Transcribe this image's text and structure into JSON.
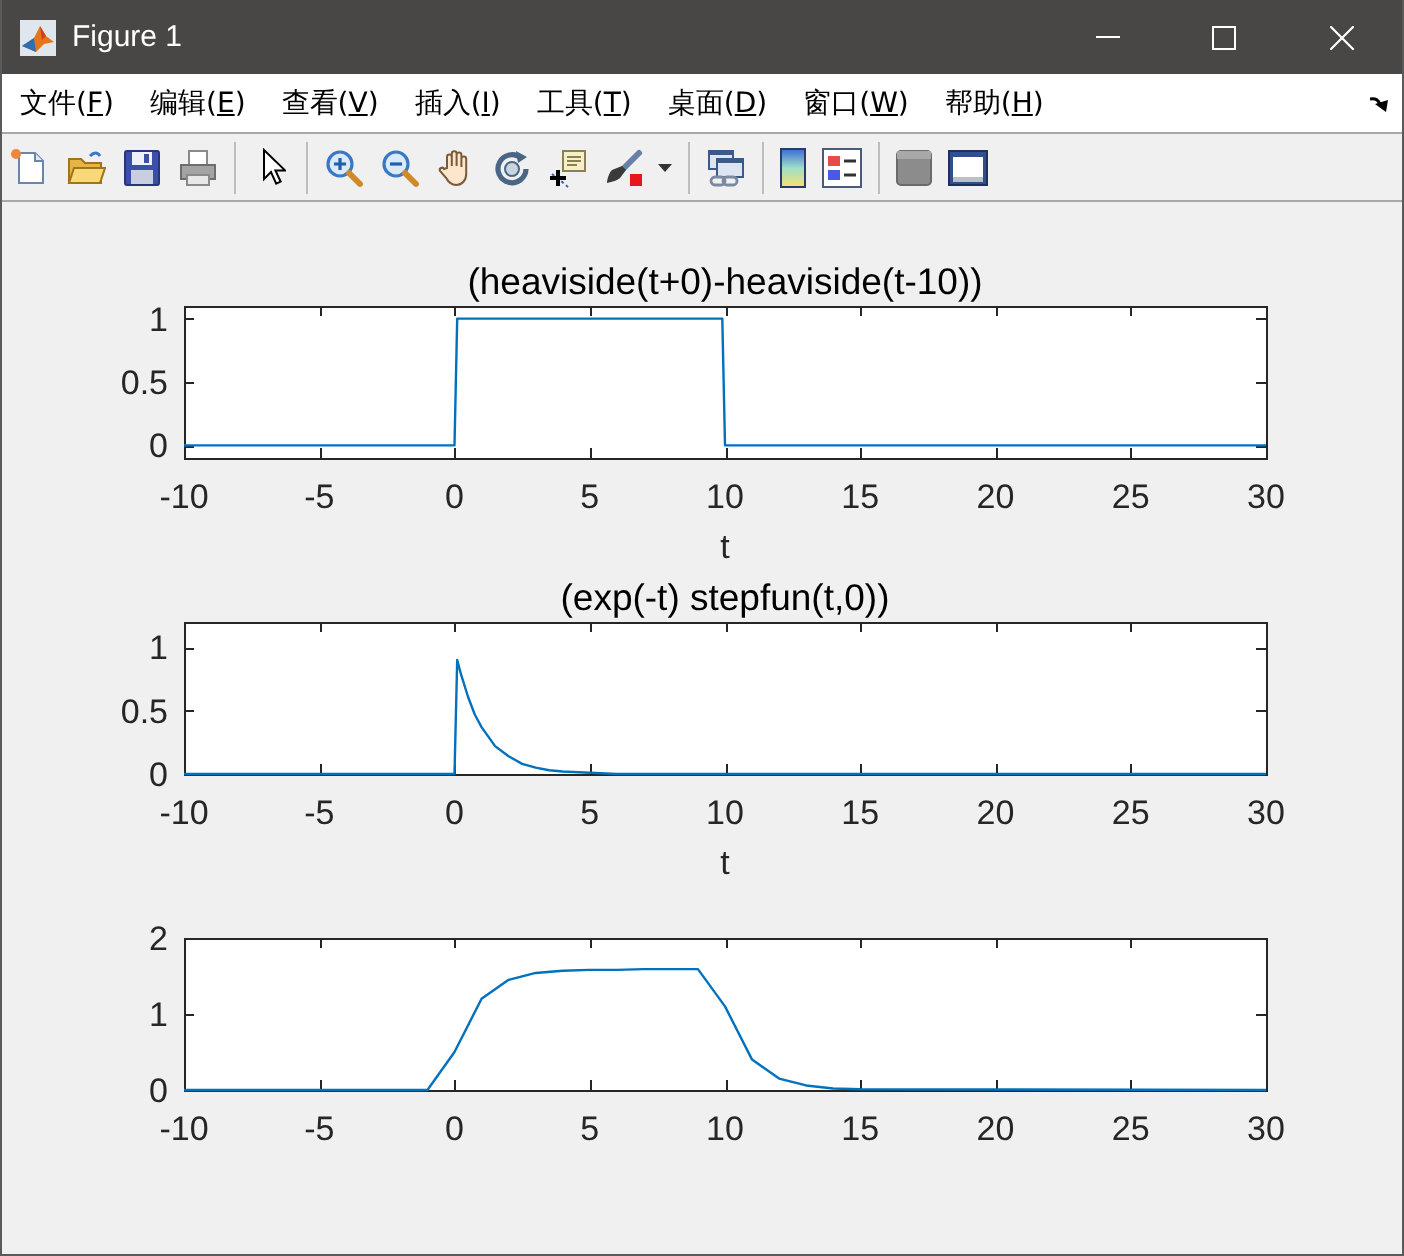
{
  "window": {
    "title": "Figure 1"
  },
  "menu_bar": {
    "items": [
      {
        "text_before": "文件(",
        "mnemonic": "F",
        "text_after": ")"
      },
      {
        "text_before": "编辑(",
        "mnemonic": "E",
        "text_after": ")"
      },
      {
        "text_before": "查看(",
        "mnemonic": "V",
        "text_after": ")"
      },
      {
        "text_before": "插入(",
        "mnemonic": "I",
        "text_after": ")"
      },
      {
        "text_before": "工具(",
        "mnemonic": "T",
        "text_after": ")"
      },
      {
        "text_before": "桌面(",
        "mnemonic": "D",
        "text_after": ")"
      },
      {
        "text_before": "窗口(",
        "mnemonic": "W",
        "text_after": ")"
      },
      {
        "text_before": "帮助(",
        "mnemonic": "H",
        "text_after": ")"
      }
    ]
  },
  "figure": {
    "axes": [
      {
        "chart_data": {
          "type": "line",
          "title": "(heaviside(t+0)-heaviside(t-10))",
          "xlabel": "t",
          "x": [
            -10,
            0,
            0.1,
            9.9,
            10,
            30
          ],
          "series": [
            {
              "color": "#0072bd",
              "values": [
                0,
                0,
                1,
                1,
                0,
                0
              ]
            }
          ],
          "xlim": [
            -10,
            30
          ],
          "ylim": [
            -0.1,
            1.1
          ],
          "xticks": [
            -10,
            -5,
            0,
            5,
            10,
            15,
            20,
            25,
            30
          ],
          "yticks": [
            0,
            0.5,
            1
          ]
        }
      },
      {
        "chart_data": {
          "type": "line",
          "title": "(exp(-t) stepfun(t,0))",
          "xlabel": "t",
          "x": [
            -10,
            0,
            0.1,
            0.25,
            0.5,
            0.75,
            1,
            1.5,
            2,
            2.5,
            3,
            3.5,
            4,
            5,
            6,
            8,
            10,
            30
          ],
          "series": [
            {
              "color": "#0072bd",
              "values": [
                0,
                0,
                0.9,
                0.78,
                0.61,
                0.47,
                0.37,
                0.22,
                0.14,
                0.08,
                0.05,
                0.03,
                0.02,
                0.01,
                0,
                0,
                0,
                0
              ]
            }
          ],
          "xlim": [
            -10,
            30
          ],
          "ylim": [
            0,
            1.2
          ],
          "xticks": [
            -10,
            -5,
            0,
            5,
            10,
            15,
            20,
            25,
            30
          ],
          "yticks": [
            0,
            0.5,
            1
          ]
        }
      },
      {
        "chart_data": {
          "type": "line",
          "x": [
            -10,
            -1,
            0,
            1,
            2,
            3,
            4,
            5,
            6,
            7,
            8,
            9,
            10,
            11,
            12,
            13,
            14,
            15,
            30
          ],
          "series": [
            {
              "color": "#0072bd",
              "values": [
                0,
                0,
                0.5,
                1.2,
                1.45,
                1.54,
                1.57,
                1.58,
                1.58,
                1.59,
                1.59,
                1.59,
                1.1,
                0.4,
                0.15,
                0.06,
                0.02,
                0.01,
                0
              ]
            }
          ],
          "xlim": [
            -10,
            30
          ],
          "ylim": [
            0,
            2
          ],
          "xticks": [
            -10,
            -5,
            0,
            5,
            10,
            15,
            20,
            25,
            30
          ],
          "yticks": [
            0,
            1,
            2
          ]
        }
      }
    ]
  }
}
